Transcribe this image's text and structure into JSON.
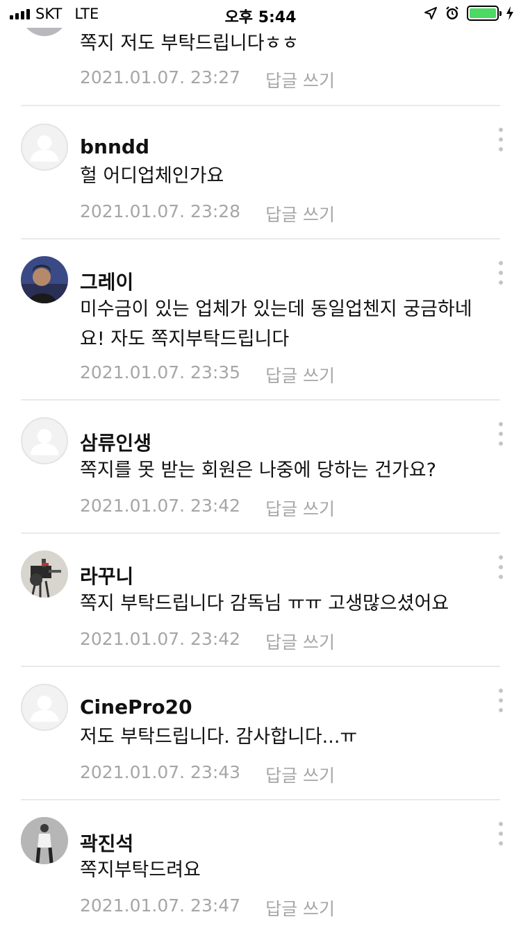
{
  "status_bar": {
    "carrier": "SKT",
    "network": "LTE",
    "time": "오후 5:44",
    "battery_color": "#4cd964"
  },
  "comments": [
    {
      "name": "",
      "text": "쪽지 저도 부탁드립니다ㅎㅎ",
      "date": "2021.01.07. 23:27",
      "reply": "답글 쓰기",
      "avatar": "photo"
    },
    {
      "name": "bnndd",
      "text": "헐 어디업체인가요",
      "date": "2021.01.07. 23:28",
      "reply": "답글 쓰기",
      "avatar": "default"
    },
    {
      "name": "그레이",
      "text": "미수금이 있는 업체가 있는데 동일업첸지 궁금하네요! 자도 쪽지부탁드립니다",
      "date": "2021.01.07. 23:35",
      "reply": "답글 쓰기",
      "avatar": "photo"
    },
    {
      "name": "삼류인생",
      "text": "쪽지를 못 받는 회원은 나중에 당하는 건가요?",
      "date": "2021.01.07. 23:42",
      "reply": "답글 쓰기",
      "avatar": "default"
    },
    {
      "name": "라꾸니",
      "text": "쪽지 부탁드립니다 감독님 ㅠㅠ 고생많으셨어요",
      "date": "2021.01.07. 23:42",
      "reply": "답글 쓰기",
      "avatar": "photo"
    },
    {
      "name": "CinePro20",
      "text": "저도 부탁드립니다. 감사합니다...ㅠ",
      "date": "2021.01.07. 23:43",
      "reply": "답글 쓰기",
      "avatar": "default"
    },
    {
      "name": "곽진석",
      "text": "쪽지부탁드려요",
      "date": "2021.01.07. 23:47",
      "reply": "답글 쓰기",
      "avatar": "photo"
    }
  ]
}
